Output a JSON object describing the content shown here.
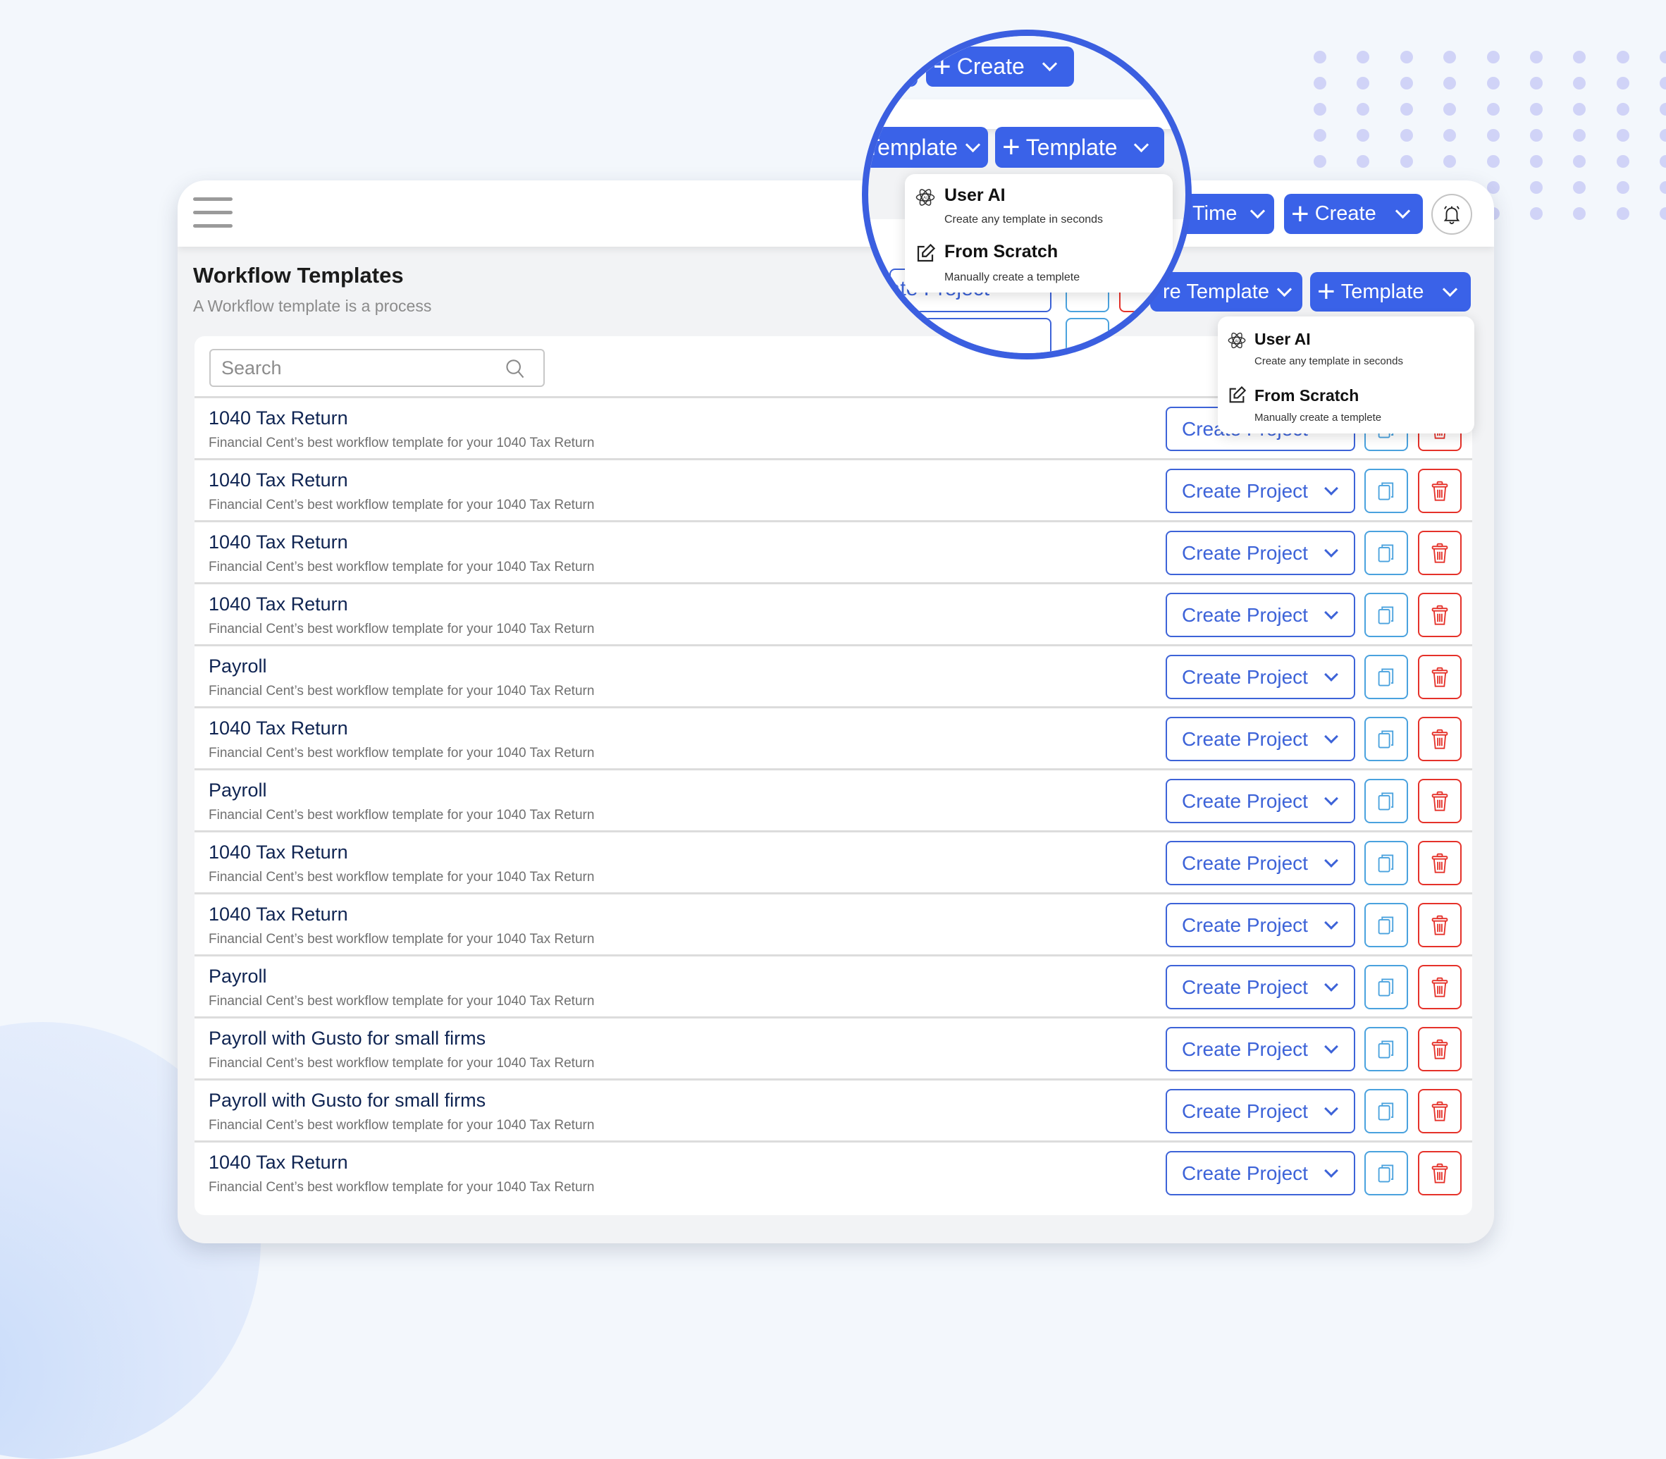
{
  "header": {
    "menu_icon": "hamburger-menu-icon",
    "time_button": "Time",
    "create_button": "Create",
    "bell_icon": "bell-icon"
  },
  "page": {
    "title": "Workflow Templates",
    "subtitle": "A Workflow template is a process"
  },
  "toolbar": {
    "share_template_button": "re Template",
    "add_template_button": "Template"
  },
  "template_dropdown": {
    "items": [
      {
        "label": "User AI",
        "description": "Create any template in seconds",
        "icon": "ai-atom-icon"
      },
      {
        "label": "From Scratch",
        "description": "Manually create a templete",
        "icon": "edit-icon"
      }
    ]
  },
  "magnifier": {
    "create_button": "Create",
    "share_template_button": "Template",
    "add_template_button": "Template",
    "partial_create_project": "eate Project"
  },
  "search": {
    "placeholder": "Search"
  },
  "row_actions": {
    "create_project": "Create Project",
    "copy_icon": "copy-icon",
    "delete_icon": "trash-icon"
  },
  "templates": [
    {
      "title": "1040 Tax Return",
      "description": "Financial Cent’s best workflow template for your 1040 Tax Return"
    },
    {
      "title": "1040 Tax Return",
      "description": "Financial Cent’s best workflow template for your 1040 Tax Return"
    },
    {
      "title": "1040 Tax Return",
      "description": "Financial Cent’s best workflow template for your 1040 Tax Return"
    },
    {
      "title": "1040 Tax Return",
      "description": "Financial Cent’s best workflow template for your 1040 Tax Return"
    },
    {
      "title": "Payroll",
      "description": "Financial Cent’s best workflow template for your 1040 Tax Return"
    },
    {
      "title": "1040 Tax Return",
      "description": "Financial Cent’s best workflow template for your 1040 Tax Return"
    },
    {
      "title": "Payroll",
      "description": "Financial Cent’s best workflow template for your 1040 Tax Return"
    },
    {
      "title": "1040 Tax Return",
      "description": "Financial Cent’s best workflow template for your 1040 Tax Return"
    },
    {
      "title": "1040 Tax Return",
      "description": "Financial Cent’s best workflow template for your 1040 Tax Return"
    },
    {
      "title": "Payroll",
      "description": "Financial Cent’s best workflow template for your 1040 Tax Return"
    },
    {
      "title": "Payroll with Gusto for small firms",
      "description": "Financial Cent’s best workflow template for your 1040 Tax Return"
    },
    {
      "title": "Payroll with Gusto for small firms",
      "description": "Financial Cent’s best workflow template for your 1040 Tax Return"
    },
    {
      "title": "1040 Tax Return",
      "description": "Financial Cent’s best workflow template for your 1040 Tax Return"
    }
  ],
  "colors": {
    "primary": "#3a62e8",
    "create_project_border": "#3d63d8",
    "copy_border": "#4aa2de",
    "delete_border": "#e5322a",
    "title_text": "#0f2452"
  }
}
